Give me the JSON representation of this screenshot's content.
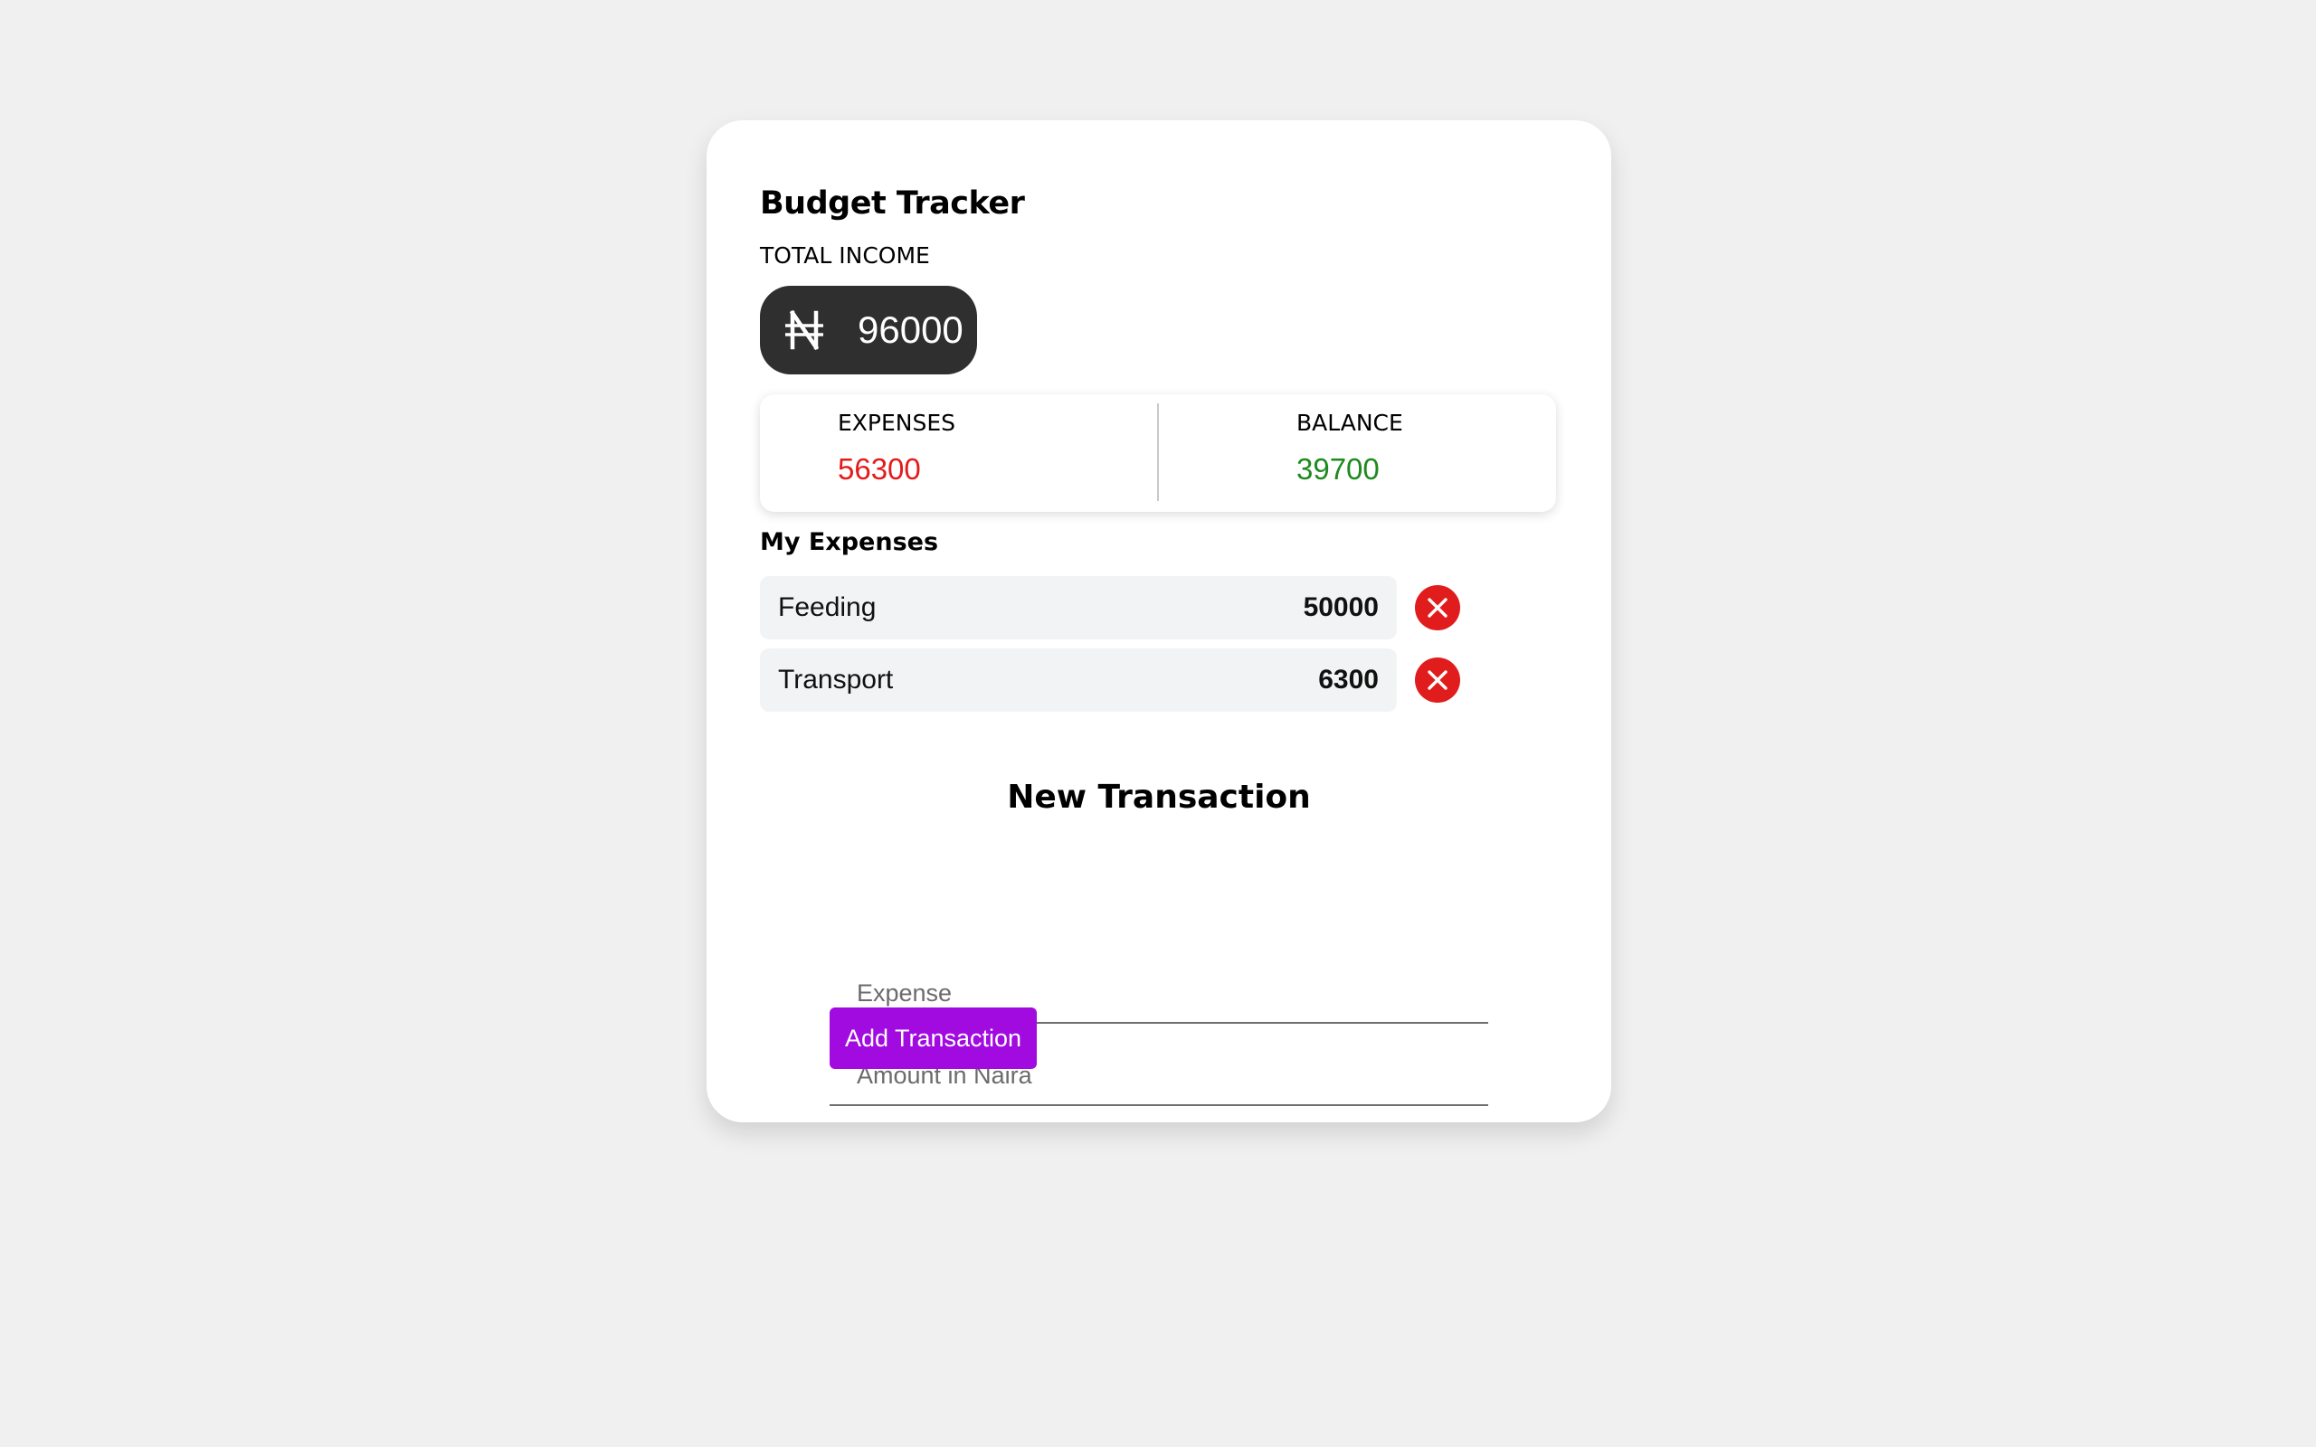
{
  "app": {
    "title": "Budget Tracker",
    "total_income_label": "TOTAL INCOME",
    "currency_icon": "naira-icon",
    "total_income_value": "96000"
  },
  "summary": {
    "expenses_label": "EXPENSES",
    "expenses_value": "56300",
    "balance_label": "BALANCE",
    "balance_value": "39700",
    "expenses_color": "#e31b1b",
    "balance_color": "#1e8a1e"
  },
  "expenses": {
    "title": "My Expenses",
    "items": [
      {
        "name": "Feeding",
        "amount": "50000",
        "delete_icon": "close-icon"
      },
      {
        "name": "Transport",
        "amount": "6300",
        "delete_icon": "close-icon"
      }
    ]
  },
  "form": {
    "title": "New Transaction",
    "expense_placeholder": "Expense",
    "amount_placeholder": "Amount in Naira",
    "submit_label": "Add Transaction",
    "submit_color": "#a10be0"
  }
}
